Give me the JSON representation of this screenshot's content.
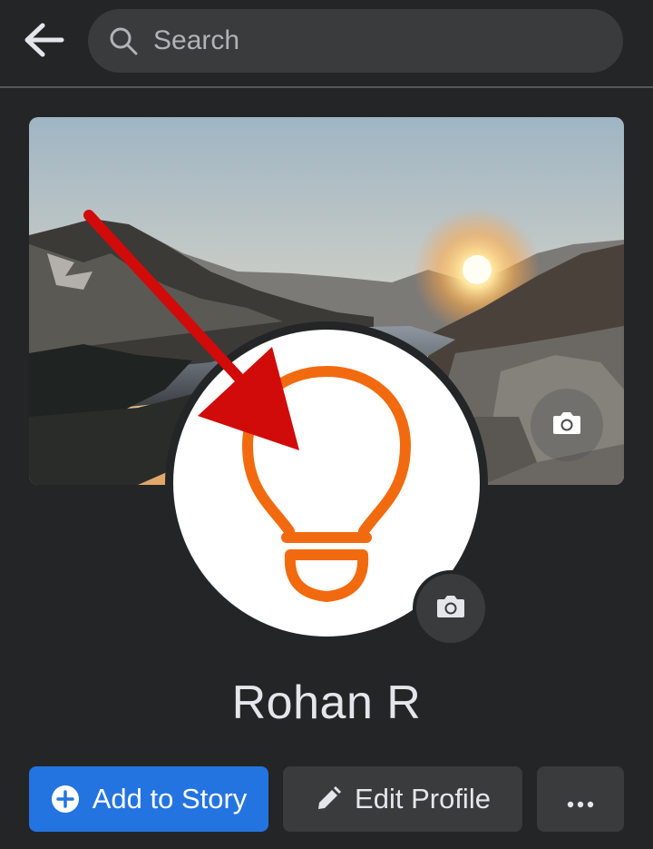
{
  "header": {
    "back_icon": "arrow-left-icon",
    "search": {
      "placeholder": "Search",
      "icon": "search-icon"
    }
  },
  "profile": {
    "cover_photo": "mountain-lake-sunset",
    "cover_camera_icon": "camera-icon",
    "avatar": "orange-lightbulb-logo",
    "avatar_camera_icon": "camera-icon",
    "name": "Rohan R"
  },
  "annotation": {
    "type": "red-arrow",
    "color": "#d10a0a",
    "points_to": "avatar"
  },
  "actions": {
    "add_story_label": "Add to Story",
    "add_story_icon": "plus-circle-icon",
    "edit_profile_label": "Edit Profile",
    "edit_profile_icon": "pencil-icon",
    "more_icon": "ellipsis-icon"
  },
  "colors": {
    "background": "#242526",
    "surface": "#3a3b3c",
    "primary": "#2374e1",
    "text": "#e4e6eb",
    "logo_orange": "#f26a0f"
  }
}
